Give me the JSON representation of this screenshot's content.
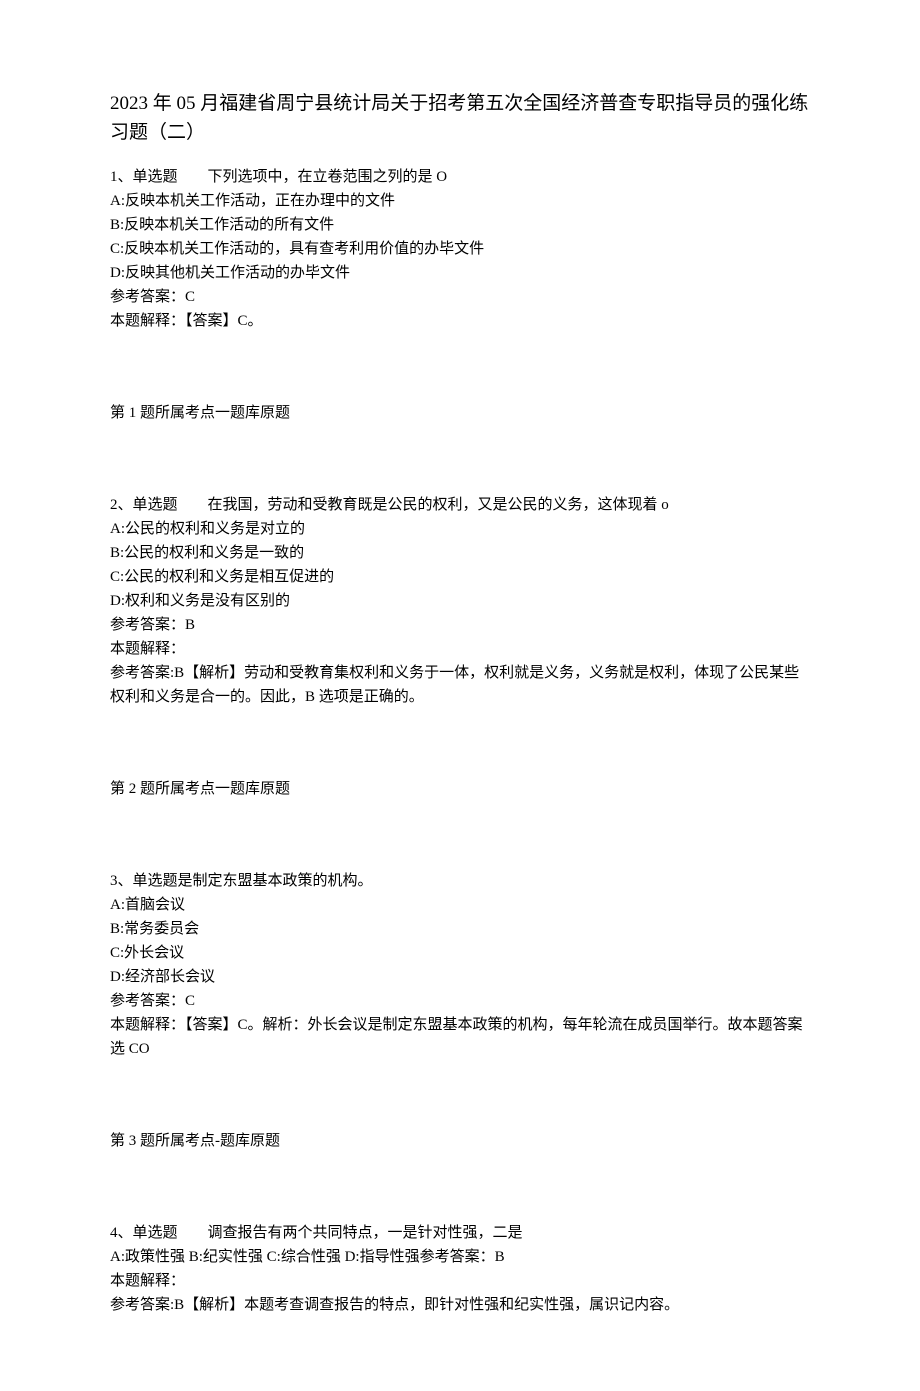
{
  "title": "2023 年 05 月福建省周宁县统计局关于招考第五次全国经济普查专职指导员的强化练习题（二）",
  "questions": [
    {
      "stem": "1、单选题　　下列选项中，在立卷范围之列的是 O",
      "options": [
        "A:反映本机关工作活动，正在办理中的文件",
        "B:反映本机关工作活动的所有文件",
        "C:反映本机关工作活动的，具有查考利用价值的办毕文件",
        "D:反映其他机关工作活动的办毕文件"
      ],
      "answer_label": "参考答案：C",
      "explain_label": "本题解释：【答案】C。",
      "footer": "第 1 题所属考点一题库原题"
    },
    {
      "stem": "2、单选题　　在我国，劳动和受教育既是公民的权利，又是公民的义务，这体现着 o",
      "options": [
        "A:公民的权利和义务是对立的",
        "B:公民的权利和义务是一致的",
        "C:公民的权利和义务是相互促进的",
        "D:权利和义务是没有区别的"
      ],
      "answer_label": "参考答案：B",
      "explain_label": "本题解释：",
      "explain_body": "参考答案:B【解析】劳动和受教育集权利和义务于一体，权利就是义务，义务就是权利，体现了公民某些权利和义务是合一的。因此，B 选项是正确的。",
      "footer": "第 2 题所属考点一题库原题"
    },
    {
      "stem": "3、单选题是制定东盟基本政策的机构。",
      "options": [
        "A:首脑会议",
        "B:常务委员会",
        "C:外长会议",
        "D:经济部长会议"
      ],
      "answer_label": "参考答案：C",
      "explain_label": "本题解释：【答案】C。解析：外长会议是制定东盟基本政策的机构，每年轮流在成员国举行。故本题答案选 CO",
      "footer": "第 3 题所属考点-题库原题"
    },
    {
      "stem": "4、单选题　　调查报告有两个共同特点，一是针对性强，二是",
      "options_inline": "A:政策性强 B:纪实性强 C:综合性强 D:指导性强参考答案：B",
      "explain_label": "本题解释：",
      "explain_body": "参考答案:B【解析】本题考查调查报告的特点，即针对性强和纪实性强，属识记内容。"
    }
  ]
}
